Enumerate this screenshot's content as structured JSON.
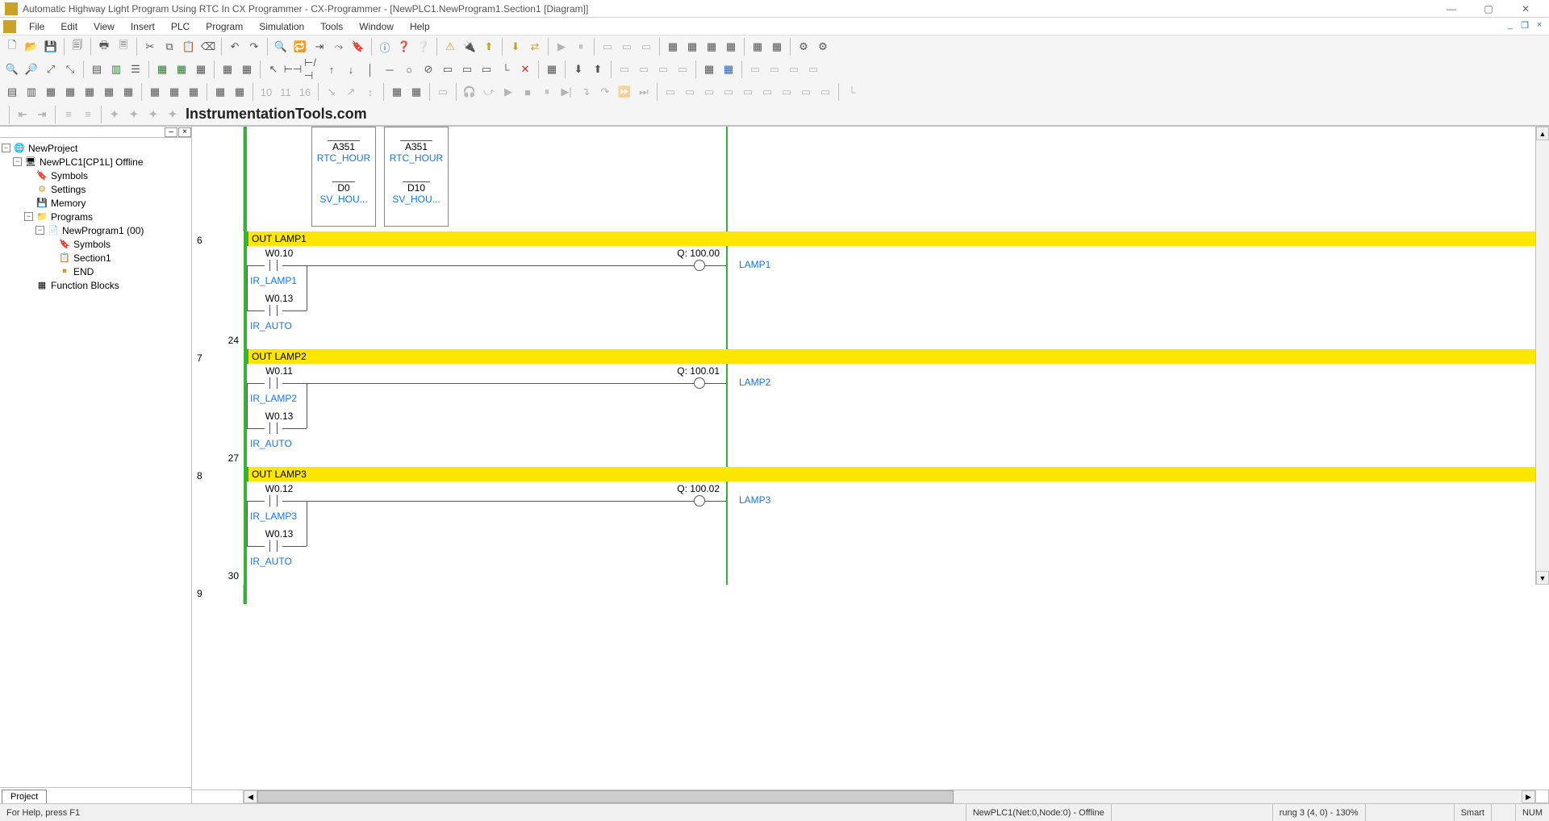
{
  "titlebar": {
    "title": "Automatic Highway Light Program Using RTC In CX Programmer - CX-Programmer - [NewPLC1.NewProgram1.Section1 [Diagram]]"
  },
  "menu": {
    "items": [
      "File",
      "Edit",
      "View",
      "Insert",
      "PLC",
      "Program",
      "Simulation",
      "Tools",
      "Window",
      "Help"
    ]
  },
  "watermark": "InstrumentationTools.com",
  "tree": {
    "root": "NewProject",
    "plc": "NewPLC1[CP1L] Offline",
    "symbols": "Symbols",
    "settings": "Settings",
    "memory": "Memory",
    "programs": "Programs",
    "program1": "NewProgram1 (00)",
    "p_symbols": "Symbols",
    "section1": "Section1",
    "end": "END",
    "fblocks": "Function Blocks",
    "tab": "Project"
  },
  "instr_boxes": {
    "b1_addr": "A351",
    "b1_sym": "RTC_HOUR",
    "b1_w": "D0",
    "b1_wsym": "SV_HOU...",
    "b2_addr": "A351",
    "b2_sym": "RTC_HOUR",
    "b2_w": "D10",
    "b2_wsym": "SV_HOU..."
  },
  "rungs": {
    "r6": {
      "n1": "6",
      "n2": "24",
      "comment": "OUT LAMP1",
      "c1_addr": "W0.10",
      "c1_sym": "IR_LAMP1",
      "c2_addr": "W0.13",
      "c2_sym": "IR_AUTO",
      "coil_addr": "Q: 100.00",
      "coil_sym": "LAMP1"
    },
    "r7": {
      "n1": "7",
      "n2": "27",
      "comment": "OUT LAMP2",
      "c1_addr": "W0.11",
      "c1_sym": "IR_LAMP2",
      "c2_addr": "W0.13",
      "c2_sym": "IR_AUTO",
      "coil_addr": "Q: 100.01",
      "coil_sym": "LAMP2"
    },
    "r8": {
      "n1": "8",
      "n2": "30",
      "comment": "OUT LAMP3",
      "c1_addr": "W0.12",
      "c1_sym": "IR_LAMP3",
      "c2_addr": "W0.13",
      "c2_sym": "IR_AUTO",
      "coil_addr": "Q: 100.02",
      "coil_sym": "LAMP3"
    },
    "r9": {
      "n1": "9"
    }
  },
  "status": {
    "help": "For Help, press F1",
    "conn": "NewPLC1(Net:0,Node:0) - Offline",
    "rung": "rung 3 (4, 0)  - 130%",
    "smart": "Smart",
    "num": "NUM"
  }
}
